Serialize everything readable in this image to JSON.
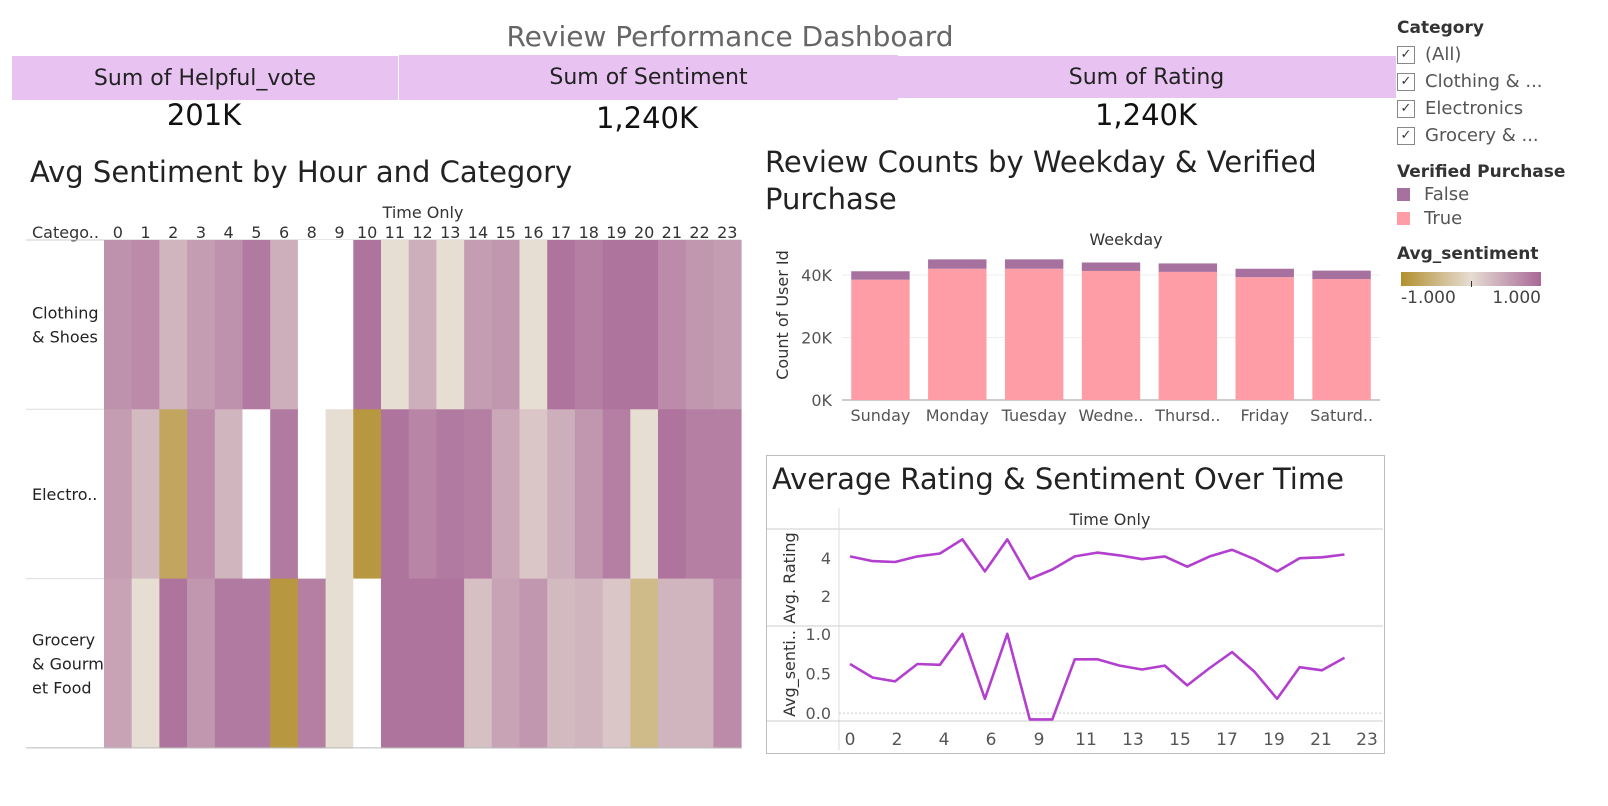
{
  "dashboard": {
    "title": "Review Performance Dashboard"
  },
  "kpis": [
    {
      "label": "Sum of Helpful_vote",
      "value": "201K"
    },
    {
      "label": "Sum of Sentiment",
      "value": "1,240K"
    },
    {
      "label": "Sum of Rating",
      "value": "1,240K"
    }
  ],
  "legends": {
    "category_title": "Category",
    "category_items": [
      "(All)",
      "Clothing & ...",
      "Electronics",
      "Grocery & ..."
    ],
    "category_checked": "✓",
    "verified_title": "Verified Purchase",
    "verified_items": [
      {
        "label": "False",
        "color": "#a6709f"
      },
      {
        "label": "True",
        "color": "#fe9da6"
      }
    ],
    "sentiment_title": "Avg_sentiment",
    "sentiment_min": "-1.000",
    "sentiment_max": "1.000",
    "sentiment_colors": {
      "low": "#b28f2e",
      "mid": "#e6ddd3",
      "high": "#a86897"
    }
  },
  "chart_data": [
    {
      "type": "heatmap",
      "title": "Avg Sentiment by Hour and Category",
      "column_header": "Time Only",
      "row_header": "Catego..",
      "columns": [
        "0",
        "1",
        "2",
        "3",
        "4",
        "5",
        "6",
        "8",
        "9",
        "10",
        "11",
        "12",
        "13",
        "14",
        "15",
        "16",
        "17",
        "18",
        "19",
        "20",
        "21",
        "22",
        "23"
      ],
      "rows": [
        {
          "label_lines": [
            "Clothing",
            "& Shoes"
          ]
        },
        {
          "label_lines": [
            "Electro.."
          ]
        },
        {
          "label_lines": [
            "Grocery",
            "& Gourm",
            "et Food"
          ]
        }
      ],
      "values": [
        [
          0.65,
          0.7,
          0.35,
          0.55,
          0.65,
          0.85,
          0.4,
          null,
          null,
          0.9,
          0.0,
          0.4,
          0.0,
          0.55,
          0.6,
          0.0,
          0.9,
          0.8,
          0.9,
          0.9,
          0.7,
          0.6,
          0.55
        ],
        [
          0.55,
          0.3,
          -0.7,
          0.7,
          0.35,
          null,
          0.85,
          null,
          0.0,
          -0.9,
          0.9,
          0.75,
          0.85,
          0.8,
          0.45,
          0.2,
          0.4,
          0.6,
          0.8,
          0.0,
          0.9,
          0.8,
          0.8
        ],
        [
          0.5,
          0.0,
          0.9,
          0.6,
          0.85,
          0.85,
          -0.9,
          0.8,
          0.0,
          null,
          0.9,
          0.9,
          0.9,
          0.25,
          0.5,
          0.6,
          0.3,
          0.35,
          0.2,
          -0.45,
          0.35,
          0.35,
          0.7
        ]
      ],
      "range": [
        -1,
        1
      ]
    },
    {
      "type": "bar",
      "title_lines": [
        "Review Counts by Weekday & Verified",
        "Purchase"
      ],
      "column_header": "Weekday",
      "ylabel": "Count of User Id",
      "categories": [
        "Sunday",
        "Monday",
        "Tuesday",
        "Wedne..",
        "Thursd..",
        "Friday",
        "Saturd.."
      ],
      "series": [
        {
          "name": "True",
          "values": [
            38500,
            42000,
            42000,
            41300,
            41000,
            39300,
            38700
          ]
        },
        {
          "name": "False",
          "values": [
            2700,
            3000,
            3000,
            2700,
            2700,
            2700,
            2700
          ]
        }
      ],
      "yticks": [
        0,
        20000,
        40000
      ],
      "ytick_labels": [
        "0K",
        "20K",
        "40K"
      ],
      "ylim": [
        0,
        48000
      ],
      "stacked": true
    },
    {
      "type": "line",
      "title": "Average Rating & Sentiment Over Time",
      "column_header": "Time Only",
      "x": [
        0,
        1,
        2,
        3,
        4,
        5,
        6,
        7,
        8,
        9,
        10,
        11,
        12,
        13,
        14,
        15,
        16,
        17,
        18,
        19,
        20,
        21,
        22,
        23
      ],
      "xtick_labels": [
        "0",
        "2",
        "4",
        "6",
        "9",
        "11",
        "13",
        "15",
        "17",
        "19",
        "21",
        "23"
      ],
      "panels": [
        {
          "ylabel": "Avg. Rating",
          "values": [
            4.1,
            3.85,
            3.8,
            4.1,
            4.25,
            5.0,
            3.3,
            5.0,
            2.9,
            3.4,
            4.1,
            4.3,
            4.15,
            3.95,
            4.1,
            3.55,
            4.1,
            4.45,
            3.95,
            3.3,
            4.0,
            4.05,
            4.2
          ],
          "yticks": [
            2,
            4
          ],
          "ylim": [
            0.4,
            5.5
          ]
        },
        {
          "ylabel": "Avg_senti..",
          "values": [
            0.62,
            0.45,
            0.4,
            0.62,
            0.61,
            1.0,
            0.18,
            1.0,
            -0.08,
            -0.08,
            0.68,
            0.68,
            0.6,
            0.55,
            0.6,
            0.35,
            0.57,
            0.77,
            0.52,
            0.18,
            0.58,
            0.54,
            0.7
          ],
          "yticks": [
            0.0,
            0.5,
            1.0
          ],
          "ylim": [
            -0.1,
            1.1
          ]
        }
      ],
      "color": "#b33fcf"
    }
  ]
}
